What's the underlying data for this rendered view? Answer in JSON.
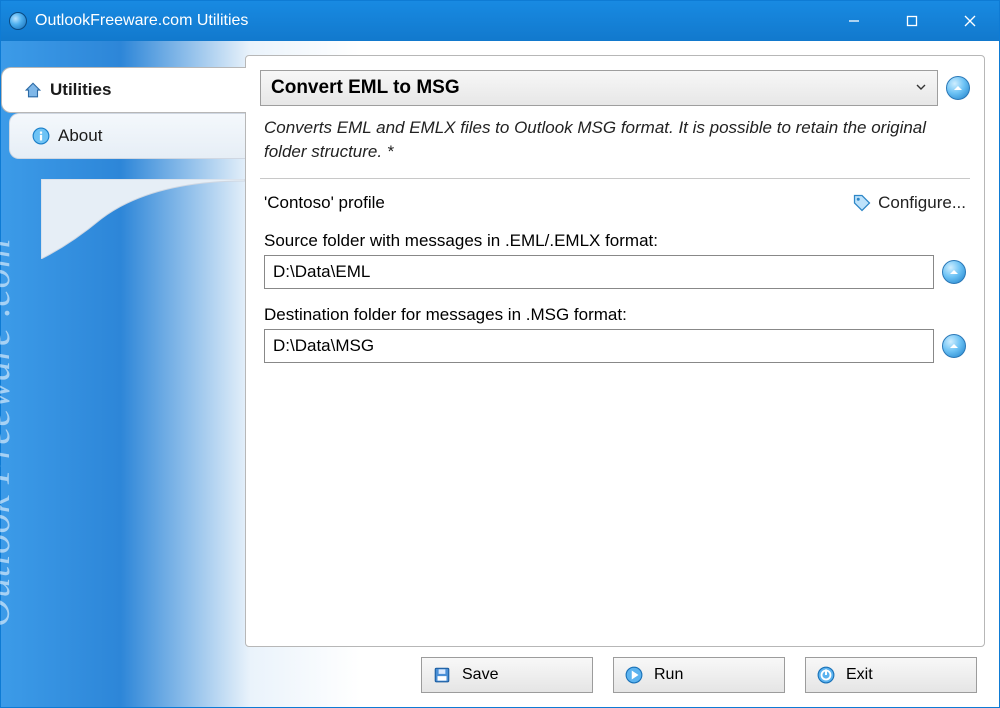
{
  "window": {
    "title": "OutlookFreeware.com Utilities"
  },
  "sidebar": {
    "items": [
      {
        "label": "Utilities",
        "icon": "home-icon",
        "active": true
      },
      {
        "label": "About",
        "icon": "info-icon",
        "active": false
      }
    ],
    "brand": "Outlook Freeware .com"
  },
  "main": {
    "utility_name": "Convert EML to MSG",
    "description": "Converts EML and EMLX files to Outlook MSG format. It is possible to retain the original folder structure. *",
    "profile_label": "'Contoso' profile",
    "configure_label": "Configure...",
    "source_label": "Source folder with messages in .EML/.EMLX format:",
    "source_value": "D:\\Data\\EML",
    "dest_label": "Destination folder for messages in .MSG format:",
    "dest_value": "D:\\Data\\MSG"
  },
  "buttons": {
    "save": "Save",
    "run": "Run",
    "exit": "Exit"
  }
}
